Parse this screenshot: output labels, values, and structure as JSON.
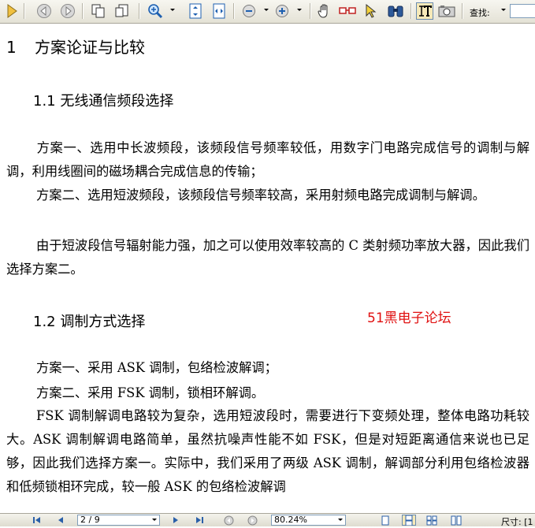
{
  "toolbar": {
    "find_label": "查找:",
    "find_value": ""
  },
  "document": {
    "h1": {
      "number": "1",
      "title": "方案论证与比较"
    },
    "section1": {
      "heading": "1.1 无线通信频段选择",
      "paragraphs": [
        "方案一、选用中长波频段，该频段信号频率较低，用数字门电路完成信号的调制与解调，利用线圈间的磁场耦合完成信息的传输；",
        "方案二、选用短波频段，该频段信号频率较高，采用射频电路完成调制与解调。",
        "由于短波段信号辐射能力强，加之可以使用效率较高的 C 类射频功率放大器，因此我们选择方案二。"
      ]
    },
    "section2": {
      "heading": "1.2 调制方式选择",
      "paragraphs": [
        "方案一、采用 ASK 调制，包络检波解调；",
        "方案二、采用 FSK 调制，锁相环解调。",
        "FSK 调制解调电路较为复杂，选用短波段时，需要进行下变频处理，整体电路功耗较大。ASK 调制解调电路简单，虽然抗噪声性能不如 FSK，但是对短距离通信来说也已足够，因此我们选择方案一。实际中，我们采用了两级 ASK 调制，解调部分利用包络检波器和低频锁相环完成，较一般 ASK 的包络检波解调"
      ]
    },
    "watermark": "51黑电子论坛"
  },
  "statusbar": {
    "page": "2 / 9",
    "zoom": "80.24%",
    "size_label": "尺寸: [1"
  },
  "colors": {
    "watermark": "#e01010"
  }
}
